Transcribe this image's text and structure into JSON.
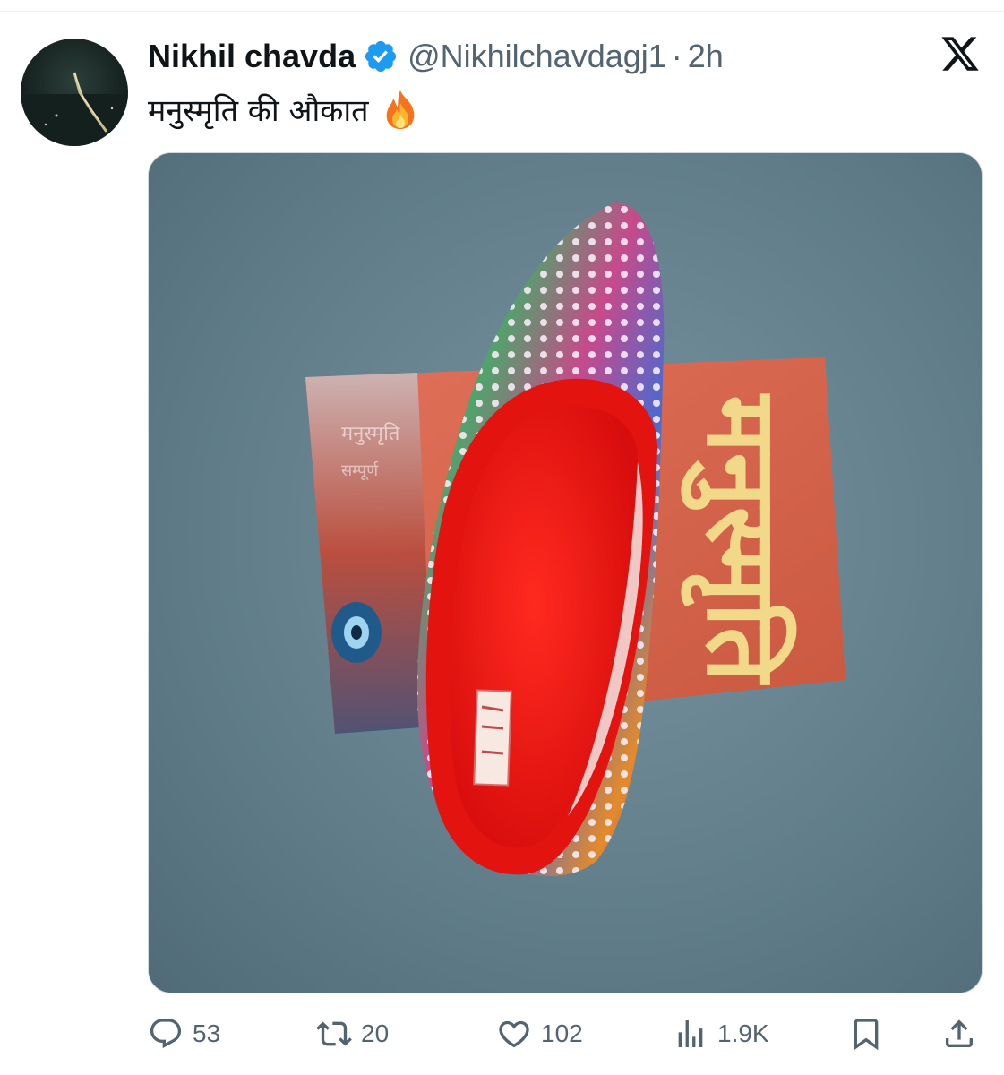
{
  "author": {
    "display_name": "Nikhil chavda",
    "handle": "@Nikhilchavdagj1",
    "separator": "·",
    "time": "2h"
  },
  "tweet": {
    "text": "मनुस्मृति की औकात"
  },
  "media": {
    "book_title": "मनुस्मृति"
  },
  "actions": {
    "replies": "53",
    "retweets": "20",
    "likes": "102",
    "views": "1.9K"
  },
  "colors": {
    "text_primary": "#0f1419",
    "text_secondary": "#536471",
    "verified_blue": "#1d9bf0",
    "border": "#cfd9de"
  },
  "icons": {
    "verified": "verified-badge-icon",
    "platform": "x-logo-icon",
    "emoji": "fire-emoji-icon",
    "reply": "reply-icon",
    "retweet": "retweet-icon",
    "like": "heart-icon",
    "views": "views-icon",
    "bookmark": "bookmark-icon",
    "share": "share-icon"
  }
}
